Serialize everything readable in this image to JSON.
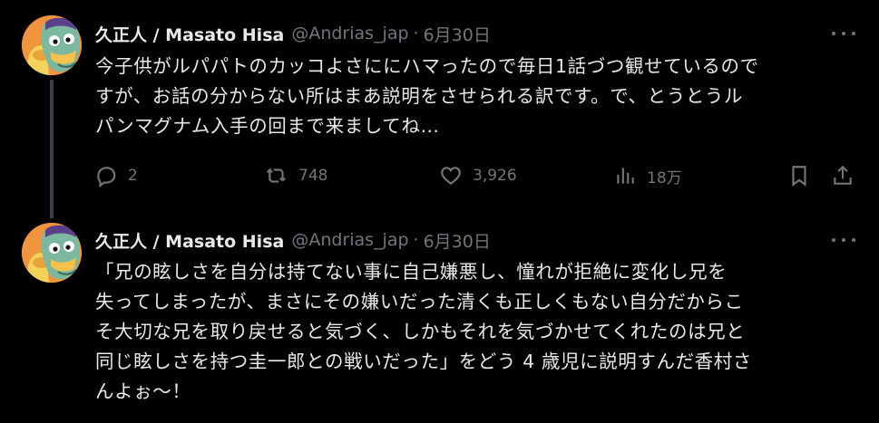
{
  "tweets": [
    {
      "author_name": "久正人 / Masato Hisa",
      "handle": "@Andrias_jap",
      "separator": "·",
      "date": "6月30日",
      "lines": [
        "今子供がルパパトのカッコよさににハマったので毎日1話づつ観せているので",
        "すが、お話の分からない所はまあ説明をさせられる訳です。で、とうとうル",
        "パンマグナム入手の回まで来ましてね…"
      ],
      "replies": "2",
      "retweets": "748",
      "likes": "3,926",
      "views": "18万"
    },
    {
      "author_name": "久正人 / Masato Hisa",
      "handle": "@Andrias_jap",
      "separator": "·",
      "date": "6月30日",
      "lines": [
        "「兄の眩しさを自分は持てない事に自己嫌悪し、憧れが拒絶に変化し兄を",
        "失ってしまったが、まさにその嫌いだった清くも正しくもない自分だからこ",
        "そ大切な兄を取り戻せると気づく、しかもそれを気づかせてくれたのは兄と",
        "同じ眩しさを持つ圭一郎との戦いだった」をどう 4 歳児に説明すんだ香村さ",
        "んよぉ～！"
      ]
    }
  ],
  "icons": {
    "avatar": "avatar-illustration",
    "more": "more-horizontal-icon",
    "reply": "reply-icon",
    "retweet": "retweet-icon",
    "like": "heart-icon",
    "views": "views-icon",
    "bookmark": "bookmark-icon",
    "share": "share-icon"
  }
}
